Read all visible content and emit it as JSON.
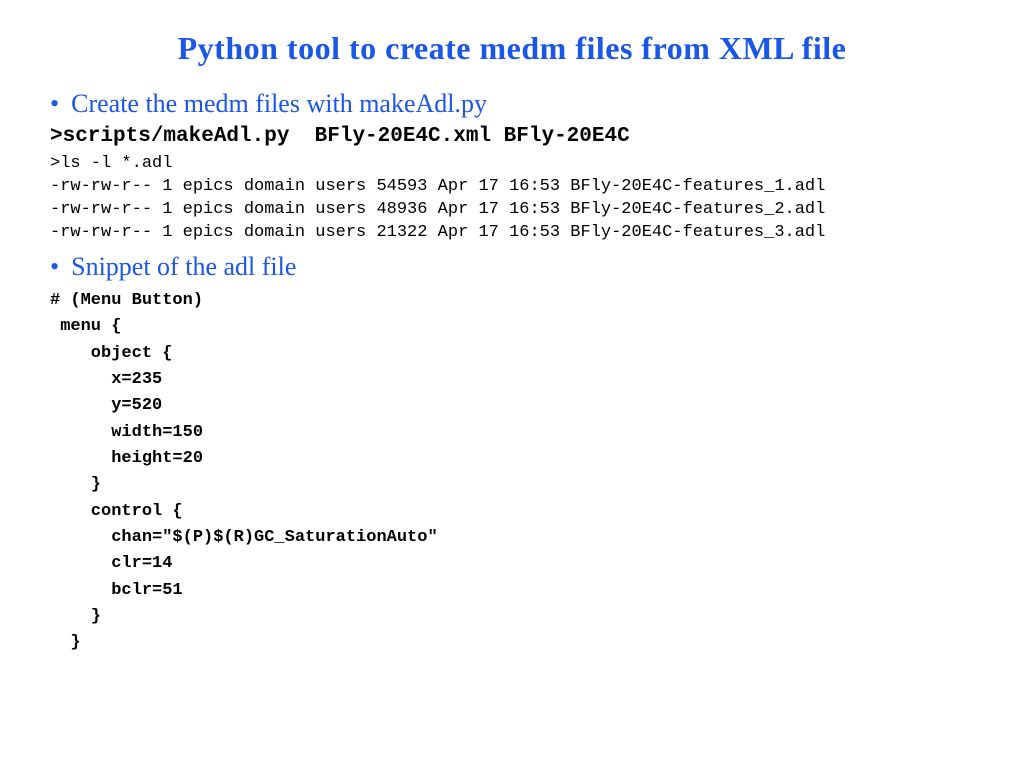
{
  "title": "Python tool to create medm files from XML file",
  "bullets": {
    "first": "Create the medm files with makeAdl.py",
    "second": "Snippet of the adl file"
  },
  "command": ">scripts/makeAdl.py  BFly-20E4C.xml BFly-20E4C",
  "ls_command": ">ls -l *.adl",
  "ls_output": {
    "line1": "-rw-rw-r-- 1 epics domain users 54593 Apr 17 16:53 BFly-20E4C-features_1.adl",
    "line2": "-rw-rw-r-- 1 epics domain users 48936 Apr 17 16:53 BFly-20E4C-features_2.adl",
    "line3": "-rw-rw-r-- 1 epics domain users 21322 Apr 17 16:53 BFly-20E4C-features_3.adl"
  },
  "code_snippet": "# (Menu Button)\n menu {\n    object {\n      x=235\n      y=520\n      width=150\n      height=20\n    }\n    control {\n      chan=\"$(P)$(R)GC_SaturationAuto\"\n      clr=14\n      bclr=51\n    }\n  }"
}
